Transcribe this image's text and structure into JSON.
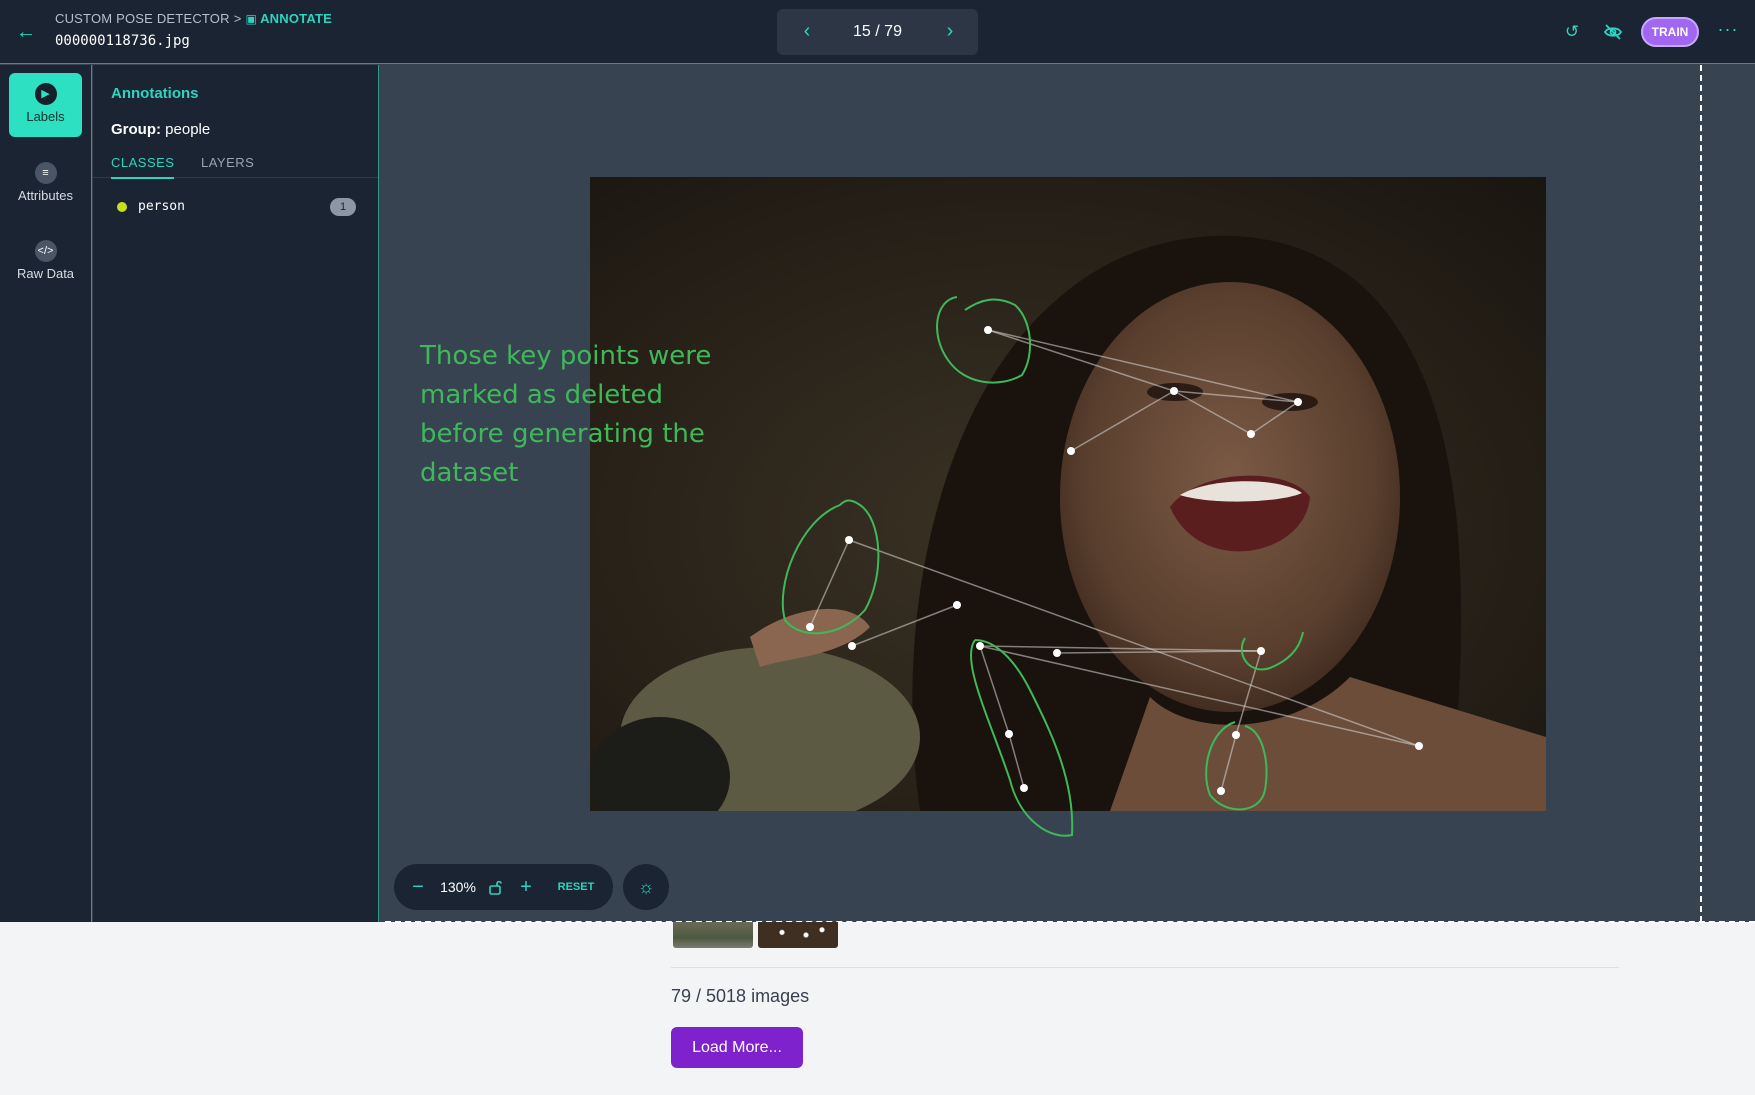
{
  "header": {
    "breadcrumb_root": "CUSTOM POSE DETECTOR",
    "breadcrumb_separator": ">",
    "breadcrumb_current": "ANNOTATE",
    "filename": "000000118736.jpg",
    "pager": "15 / 79",
    "train_label": "TRAIN",
    "more_label": "···",
    "accent_color": "#2dd4bf",
    "train_color": "#a167f0"
  },
  "rail": {
    "items": [
      {
        "label": "Labels",
        "icon": "label-icon",
        "active": true
      },
      {
        "label": "Attributes",
        "icon": "list-icon",
        "active": false
      },
      {
        "label": "Raw Data",
        "icon": "code-icon",
        "active": false
      }
    ]
  },
  "panel": {
    "title": "Annotations",
    "group_label": "Group:",
    "group_value": "people",
    "tabs": [
      "CLASSES",
      "LAYERS"
    ],
    "classes": [
      {
        "name": "person",
        "count": "1",
        "color": "#c6e11a"
      }
    ]
  },
  "canvas": {
    "note": "Those key points were marked as deleted before generating the dataset",
    "note_color": "#3fb85a",
    "zoom_level": "130%",
    "reset_label": "RESET"
  },
  "gallery": {
    "images_count": "79 / 5018 images",
    "load_more_label": "Load More..."
  }
}
